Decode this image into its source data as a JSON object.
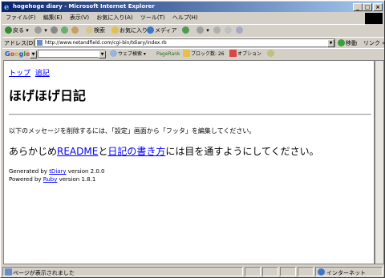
{
  "window": {
    "title": "hogehoge diary - Microsoft Internet Explorer"
  },
  "menu": [
    "ファイル(F)",
    "編集(E)",
    "表示(V)",
    "お気に入り(A)",
    "ツール(T)",
    "ヘルプ(H)"
  ],
  "toolbar": {
    "back": "戻る",
    "search": "検索",
    "favorites": "お気に入り",
    "media": "メディア"
  },
  "address": {
    "label": "アドレス(D)",
    "url": "http://www.netandfield.com/cgi-bin/tdiary/index.rb",
    "go": "移動",
    "links": "リンク"
  },
  "google": {
    "logo": "Google",
    "web_search": "ウェブ検索",
    "pagerank": "PageRank",
    "popup_block": "ブロック数: 26",
    "options": "オプション"
  },
  "page": {
    "nav": [
      "トップ",
      "追記"
    ],
    "heading": "ほげほげ日記",
    "message": "以下のメッセージを削除するには、「設定」画面から「フッタ」を編集してください。",
    "notice_pre": "あらかじめ",
    "notice_link1": "README",
    "notice_mid": "と",
    "notice_link2": "日記の書き方",
    "notice_post": "には目を通すようにしてください。",
    "generated_pre": "Generated by ",
    "generated_link": "tDiary",
    "generated_post": " version 2.0.0",
    "powered_pre": "Powered by ",
    "powered_link": "Ruby",
    "powered_post": " version 1.8.1"
  },
  "status": {
    "left": "ページが表示されました",
    "zone": "インターネット"
  }
}
